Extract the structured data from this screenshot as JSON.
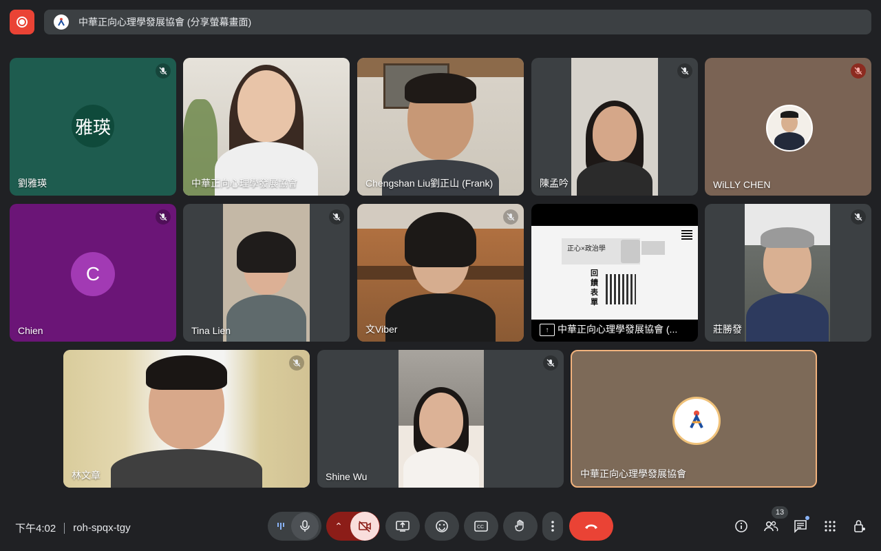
{
  "header": {
    "title": "中華正向心理學發展協會 (分享螢幕畫面)"
  },
  "tiles": [
    {
      "name": "劉雅瑛",
      "avatar_text": "雅瑛",
      "muted": true
    },
    {
      "name": "中華正向心理學發展協會",
      "muted": false
    },
    {
      "name": "Chengshan Liu劉正山 (Frank)",
      "muted": false
    },
    {
      "name": "陳孟吟",
      "muted": true
    },
    {
      "name": "WiLLY CHEN",
      "muted": true
    },
    {
      "name": "Chien",
      "avatar_text": "C",
      "muted": true
    },
    {
      "name": "Tina Lien",
      "muted": true
    },
    {
      "name": "文Viber",
      "muted": true
    },
    {
      "name": "中華正向心理學發展協會 (...",
      "muted": false
    },
    {
      "name": "莊勝發",
      "muted": true
    },
    {
      "name": "林文章",
      "muted": true
    },
    {
      "name": "Shine Wu",
      "muted": true
    },
    {
      "name": "中華正向心理學發展協會",
      "muted": false
    }
  ],
  "slide": {
    "heading": "正心×政治學",
    "side_text": "回饋表單"
  },
  "footer": {
    "time": "下午4:02",
    "meeting_code": "roh-spqx-tgy",
    "participants_count": "13"
  },
  "colors": {
    "accent_red": "#ea4335",
    "tile_bg": "#3c4043",
    "speaking_border": "#f2b37d"
  }
}
